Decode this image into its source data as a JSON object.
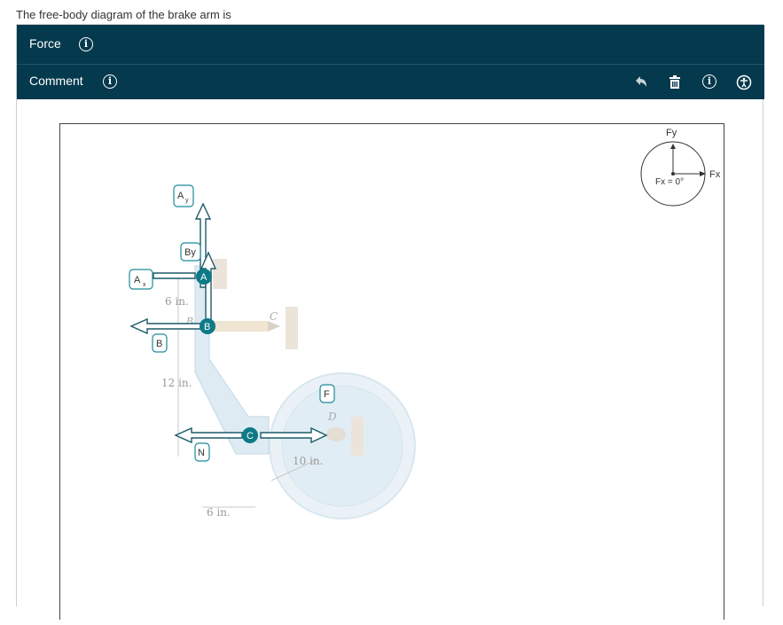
{
  "question": "The free-body diagram of the brake arm is",
  "toolbar": {
    "force_label": "Force",
    "comment_label": "Comment",
    "icons": [
      "info-icon",
      "undo-icon",
      "trash-icon",
      "info-icon",
      "accessibility-icon"
    ]
  },
  "colors": {
    "header_bg": "#05394d",
    "node": "#0f7a87",
    "arrow_outline": "#1c5a6a"
  },
  "diagram": {
    "dims": {
      "d6_top": "6 in.",
      "d12": "12 in.",
      "d10": "10 in.",
      "d6_bottom": "6 in."
    },
    "points": {
      "A": "A",
      "B_small": "B",
      "C": "C",
      "D": "D"
    },
    "nodes": {
      "A": "A",
      "B": "B",
      "C": "C"
    },
    "force_labels": {
      "Ay": "A",
      "Ay_sub": "y",
      "By": "By",
      "Ax": "A",
      "Ax_sub": "x",
      "B": "B",
      "F": "F",
      "N": "N"
    }
  },
  "compass": {
    "fy": "Fy",
    "fx": "Fx",
    "readout": "Fx = 0°"
  }
}
